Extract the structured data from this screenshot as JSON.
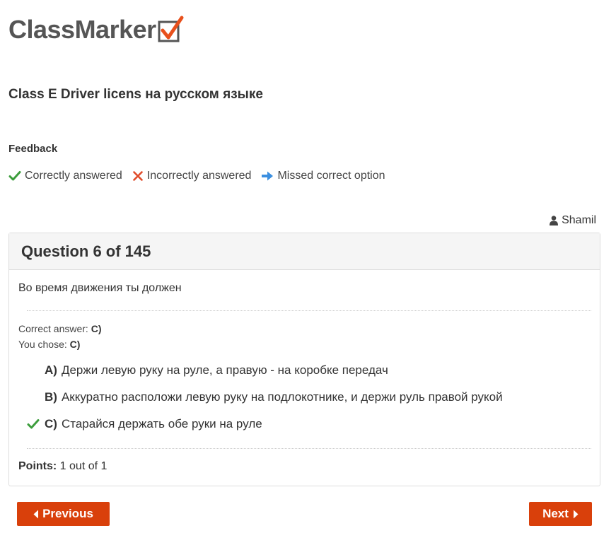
{
  "logo": {
    "text": "ClassMarker",
    "icon": "checkbox-check-icon"
  },
  "test_title": "Class E Driver licens на русском языке",
  "feedback": {
    "title": "Feedback",
    "legend": [
      {
        "icon": "check-icon",
        "label": "Correctly answered",
        "color": "#3c9d3c"
      },
      {
        "icon": "cross-icon",
        "label": "Incorrectly answered",
        "color": "#e04b2a"
      },
      {
        "icon": "arrow-right-icon",
        "label": "Missed correct option",
        "color": "#3b8fe0"
      }
    ]
  },
  "user": {
    "icon": "user-icon",
    "name": "Shamil"
  },
  "question": {
    "heading": "Question 6 of 145",
    "text": "Во время движения ты должен",
    "correct_answer_label": "Correct answer:",
    "correct_answer_value": "C)",
    "you_chose_label": "You chose:",
    "you_chose_value": "C)",
    "options": [
      {
        "letter": "A)",
        "text": "Держи левую руку на руле, а правую - на коробке передач",
        "status": ""
      },
      {
        "letter": "B)",
        "text": "Аккуратно расположи левую руку на подлокотнике, и держи руль правой рукой",
        "status": ""
      },
      {
        "letter": "C)",
        "text": "Старайся держать обе руки на руле",
        "status": "correct"
      }
    ],
    "points_label": "Points:",
    "points_value": "1 out of 1"
  },
  "nav": {
    "previous_label": "Previous",
    "next_label": "Next",
    "button_color": "#d9400b"
  }
}
